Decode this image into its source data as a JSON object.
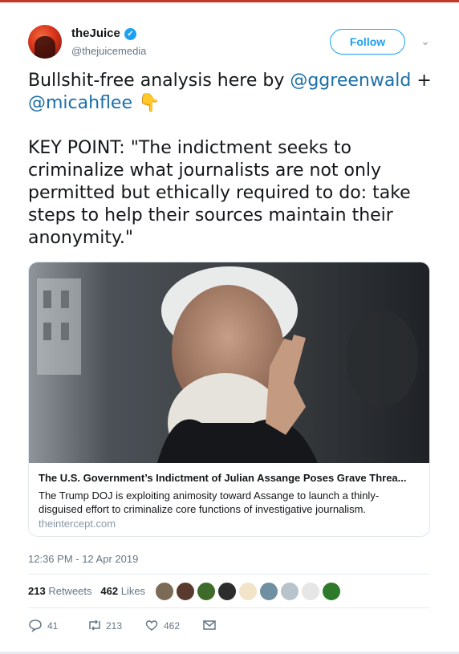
{
  "user": {
    "display_name": "theJuice",
    "handle": "@thejuicemedia",
    "verified_glyph": "✓",
    "follow_label": "Follow",
    "menu_glyph": "⌄"
  },
  "tweet": {
    "line1_prefix": "Bullshit-free analysis here by ",
    "mention1": "@ggreenwald",
    "line1_suffix": " +",
    "mention2": "@micahflee",
    "emoji": "👇",
    "body": "KEY  POINT: \"The indictment seeks to criminalize what journalists are not  only permitted but ethically required to do: take steps to help their  sources maintain their anonymity.\""
  },
  "card": {
    "title": "The U.S. Government’s Indictment of Julian Assange Poses Grave Threa...",
    "description": "The Trump DOJ is exploiting animosity toward Assange to launch a thinly-disguised effort to criminalize core functions of investigative journalism.",
    "domain": "theintercept.com"
  },
  "meta": {
    "timestamp": "12:36 PM - 12 Apr 2019"
  },
  "stats": {
    "retweets_count": "213",
    "retweets_label": "Retweets",
    "likes_count": "462",
    "likes_label": "Likes"
  },
  "actions": {
    "replies": "41",
    "retweets": "213",
    "likes": "462"
  },
  "colors": {
    "accent": "#1da1f2",
    "mention": "#1b6fa8",
    "muted": "#657786"
  }
}
